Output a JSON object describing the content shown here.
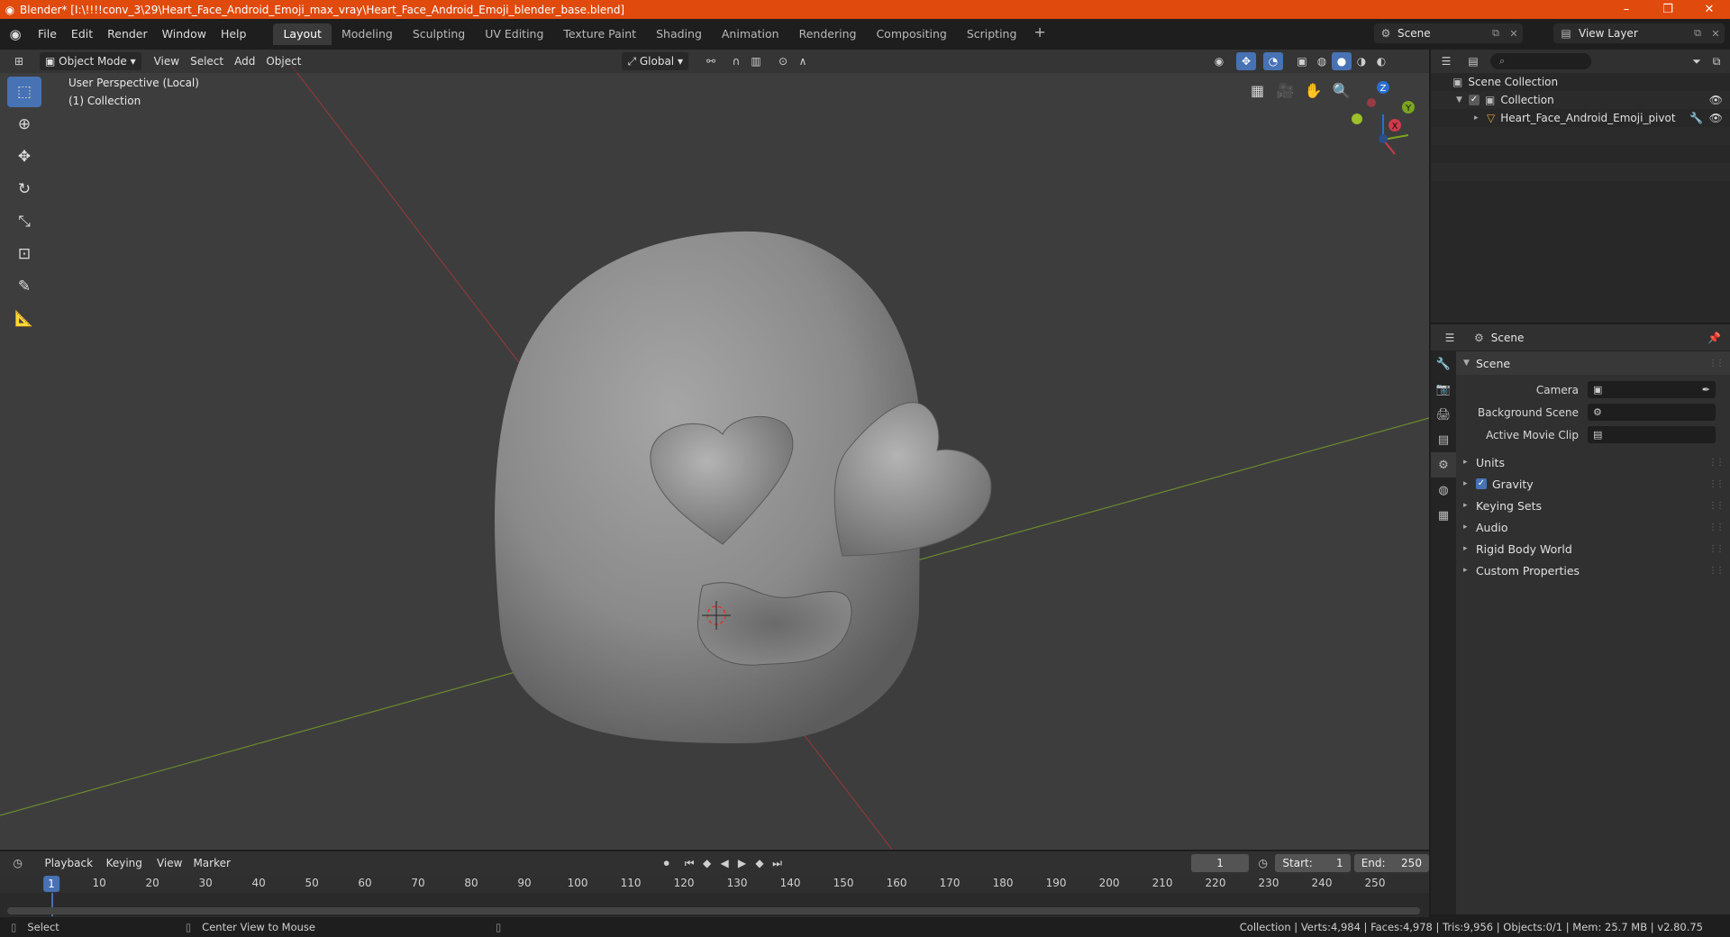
{
  "window": {
    "title": "Blender* [I:\\!!!!conv_3\\29\\Heart_Face_Android_Emoji_max_vray\\Heart_Face_Android_Emoji_blender_base.blend]",
    "controls": [
      "–",
      "❐",
      "✕"
    ]
  },
  "menu": [
    "File",
    "Edit",
    "Render",
    "Window",
    "Help"
  ],
  "workspaces": [
    "Layout",
    "Modeling",
    "Sculpting",
    "UV Editing",
    "Texture Paint",
    "Shading",
    "Animation",
    "Rendering",
    "Compositing",
    "Scripting"
  ],
  "active_workspace": "Layout",
  "scene_name": "Scene",
  "view_layer": "View Layer",
  "viewport": {
    "mode": "Object Mode",
    "menus": [
      "View",
      "Select",
      "Add",
      "Object"
    ],
    "orientation": "Global",
    "perspective_label": "User Perspective (Local)",
    "collection_label": "(1) Collection",
    "gizmo_axes": [
      "Z",
      "Y",
      "X"
    ],
    "accent": "#4772b3"
  },
  "outliner": {
    "root": "Scene Collection",
    "collection": "Collection",
    "object": "Heart_Face_Android_Emoji_pivot"
  },
  "properties": {
    "header": "Scene",
    "panel": "Scene",
    "fields": [
      {
        "label": "Camera"
      },
      {
        "label": "Background Scene"
      },
      {
        "label": "Active Movie Clip"
      }
    ],
    "subpanels": [
      "Units",
      "Gravity",
      "Keying Sets",
      "Audio",
      "Rigid Body World",
      "Custom Properties"
    ]
  },
  "timeline": {
    "menus": [
      "Playback",
      "Keying",
      "View",
      "Marker"
    ],
    "current_frame": "1",
    "start_label": "Start:",
    "start": "1",
    "end_label": "End:",
    "end": "250",
    "ticks": [
      "1",
      "10",
      "20",
      "30",
      "40",
      "50",
      "60",
      "70",
      "80",
      "90",
      "100",
      "110",
      "120",
      "130",
      "140",
      "150",
      "160",
      "170",
      "180",
      "190",
      "200",
      "210",
      "220",
      "230",
      "240",
      "250"
    ]
  },
  "status": {
    "select": "Select",
    "center": "Center View to Mouse",
    "stats": "Collection | Verts:4,984 | Faces:4,978 | Tris:9,956 | Objects:0/1 | Mem: 25.7 MB | v2.80.75"
  }
}
